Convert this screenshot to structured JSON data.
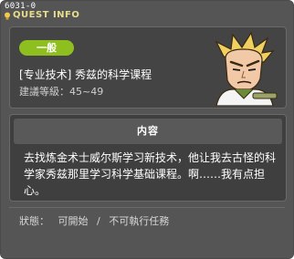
{
  "window": {
    "quest_id": "6031-0",
    "title": "QUEST INFO"
  },
  "quest": {
    "type_badge": "一般",
    "name": "[专业技术] 秀兹的科学课程",
    "level_label": "建議等級：45~49",
    "npc": "gruff-blond-npc-portrait"
  },
  "content": {
    "header": "内容",
    "text": "去找炼金术士威尔斯学习新技术，他让我去古怪的科学家秀兹那里学习科学基础课程。啊……我有点担心。"
  },
  "status": {
    "label": "狀態：",
    "available": "可開始",
    "separator": "/",
    "unavailable": "不可執行任務"
  },
  "colors": {
    "window_bg": "#555555",
    "panel_bg": "#444444",
    "badge_green": "#8fbf1f",
    "title_yellow": "#e8dd8b"
  }
}
